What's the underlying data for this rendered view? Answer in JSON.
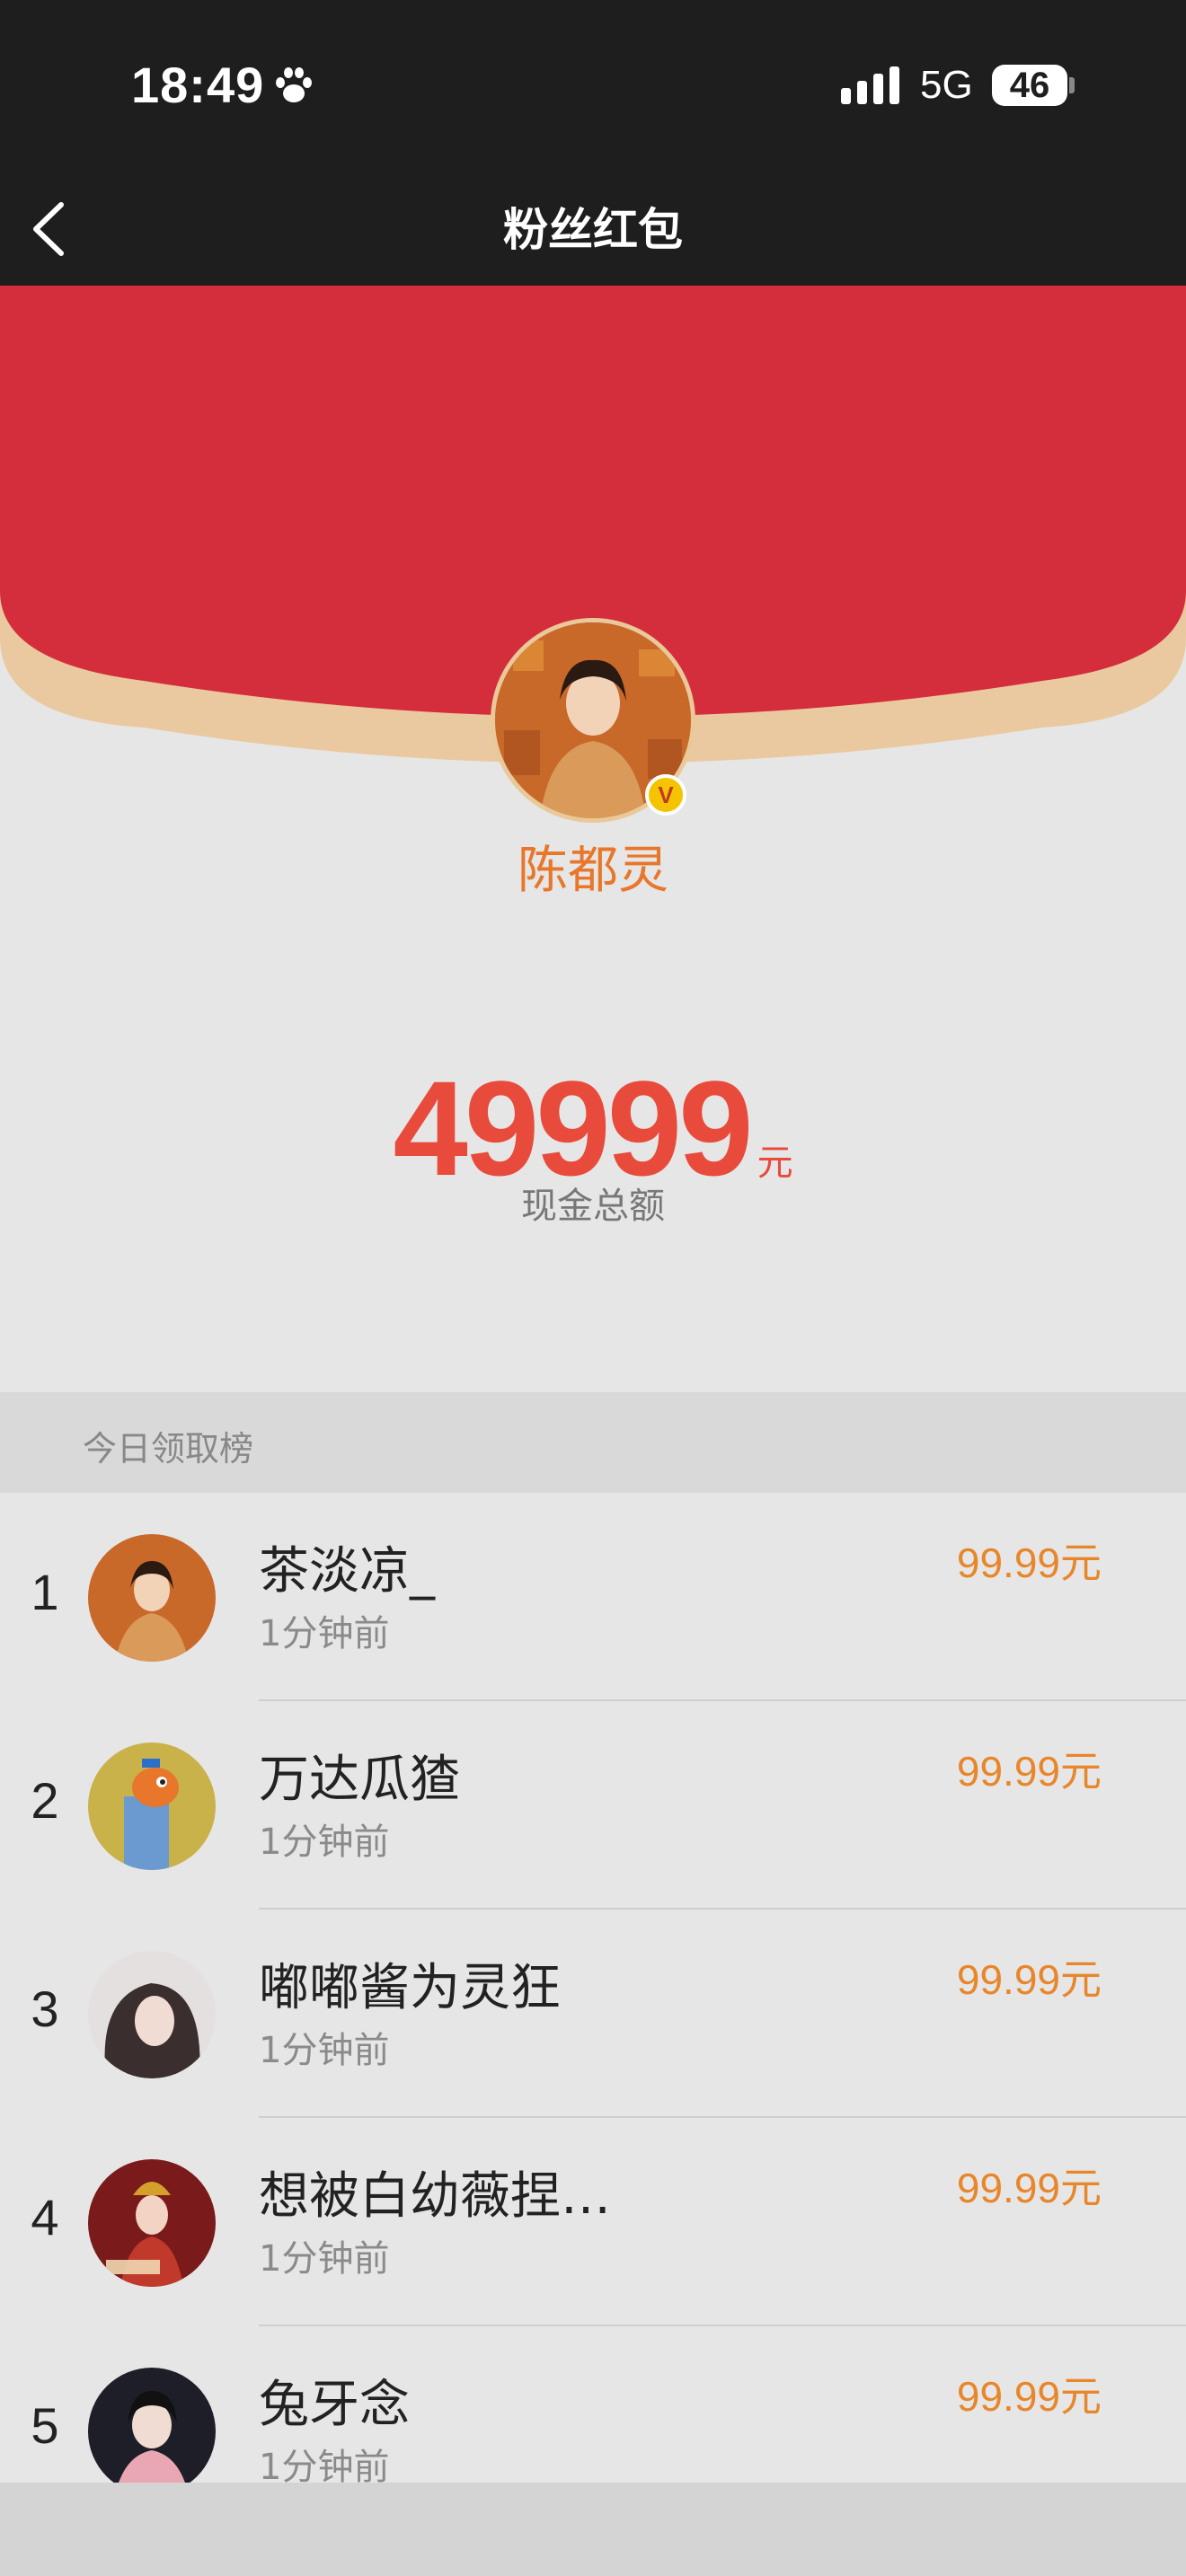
{
  "status_bar": {
    "time": "18:49",
    "network": "5G",
    "battery": "46"
  },
  "nav": {
    "title": "粉丝红包"
  },
  "host": {
    "name": "陈都灵",
    "verified_badge": "V"
  },
  "amount": {
    "value": "49999",
    "unit": "元",
    "label": "现金总额"
  },
  "ranking": {
    "header": "今日领取榜",
    "rows": [
      {
        "rank": "1",
        "name": "茶淡凉_",
        "time": "1分钟前",
        "amount": "99.99元"
      },
      {
        "rank": "2",
        "name": "万达瓜猹",
        "time": "1分钟前",
        "amount": "99.99元"
      },
      {
        "rank": "3",
        "name": "嘟嘟酱为灵狂",
        "time": "1分钟前",
        "amount": "99.99元"
      },
      {
        "rank": "4",
        "name": "想被白幼薇捏…",
        "time": "1分钟前",
        "amount": "99.99元"
      },
      {
        "rank": "5",
        "name": "兔牙念",
        "time": "1分钟前",
        "amount": "99.99元"
      }
    ]
  },
  "colors": {
    "red": "#d42d3b",
    "orange": "#e8762b",
    "amount_red": "#e84b3c",
    "rim": "#ebc9a0"
  }
}
